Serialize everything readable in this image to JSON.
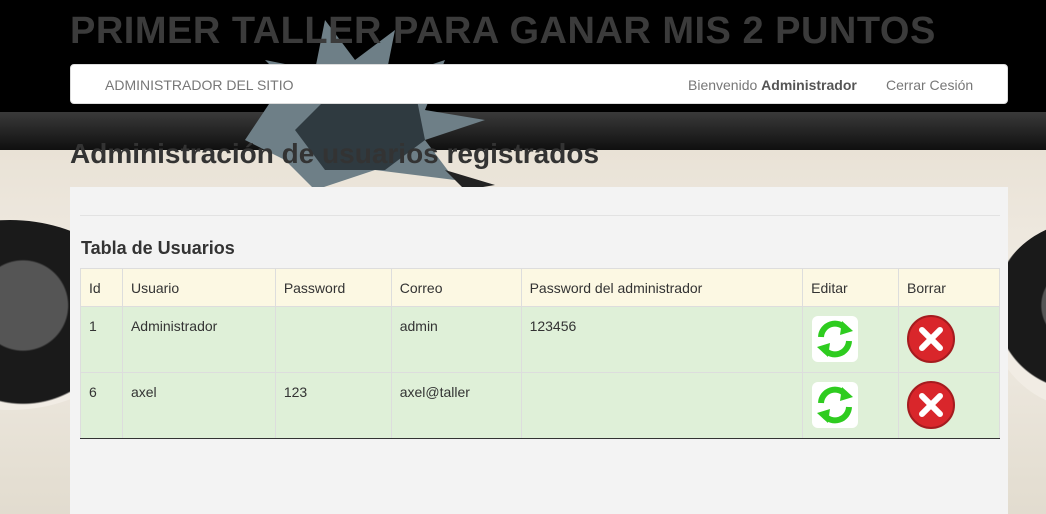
{
  "header": {
    "site_title": "PRIMER TALLER PARA GANAR MIS 2 PUNTOS"
  },
  "navbar": {
    "brand": "ADMINISTRADOR DEL SITIO",
    "welcome_prefix": "Bienvenido ",
    "welcome_user": "Administrador",
    "logout": "Cerrar Cesión"
  },
  "main": {
    "heading": "Administración de usuarios registrados",
    "table_title": "Tabla de Usuarios",
    "columns": [
      "Id",
      "Usuario",
      "Password",
      "Correo",
      "Password del administrador",
      "Editar",
      "Borrar"
    ],
    "rows": [
      {
        "id": "1",
        "usuario": "Administrador",
        "password": "",
        "correo": "admin",
        "admin_password": "123456"
      },
      {
        "id": "6",
        "usuario": "axel",
        "password": "123",
        "correo": "axel@taller",
        "admin_password": ""
      }
    ],
    "edit_icon": "refresh-icon",
    "delete_icon": "delete-icon"
  },
  "colors": {
    "header_row": "#fcf8e3",
    "data_row": "#dff0d8",
    "edit_green": "#2ecc1f",
    "delete_red": "#d9262b"
  }
}
